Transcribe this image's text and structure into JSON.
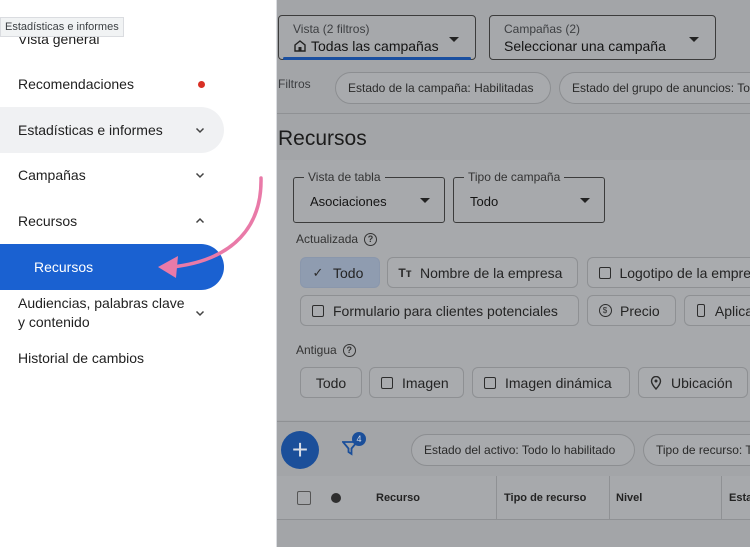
{
  "tooltip": "Estadísticas e informes",
  "sidebar": {
    "items": [
      {
        "label": "Vista general"
      },
      {
        "label": "Recomendaciones"
      },
      {
        "label": "Estadísticas e informes"
      },
      {
        "label": "Campañas"
      },
      {
        "label": "Recursos"
      },
      {
        "label": "Recursos"
      },
      {
        "label": "Audiencias, palabras clave y contenido"
      },
      {
        "label": "Historial de cambios"
      }
    ]
  },
  "header": {
    "view": {
      "label": "Vista (2 filtros)",
      "value": "Todas las campañas"
    },
    "campaigns": {
      "label": "Campañas (2)",
      "value": "Seleccionar una campaña"
    }
  },
  "filters": {
    "label": "Filtros",
    "chips": [
      "Estado de la campaña: Habilitadas",
      "Estado del grupo de anuncios: To"
    ]
  },
  "page": {
    "title": "Recursos"
  },
  "table_view": {
    "legend": "Vista de tabla",
    "value": "Asociaciones"
  },
  "campaign_type": {
    "legend": "Tipo de campaña",
    "value": "Todo"
  },
  "updated": {
    "label": "Actualizada",
    "buttons": [
      "Todo",
      "Nombre de la empresa",
      "Logotipo de la empre",
      "Formulario para clientes potenciales",
      "Precio",
      "Aplica"
    ]
  },
  "old": {
    "label": "Antigua",
    "buttons": [
      "Todo",
      "Imagen",
      "Imagen dinámica",
      "Ubicación"
    ]
  },
  "toolbar": {
    "filter_count": "4",
    "chips": [
      "Estado del activo: Todo lo habilitado",
      "Tipo de recurso: T"
    ]
  },
  "table": {
    "headers": [
      "Recurso",
      "Tipo de recurso",
      "Nivel",
      "Esta"
    ]
  },
  "colors": {
    "accent": "#1a61d1",
    "arrow": "#e97aa8",
    "alert": "#d93025"
  }
}
